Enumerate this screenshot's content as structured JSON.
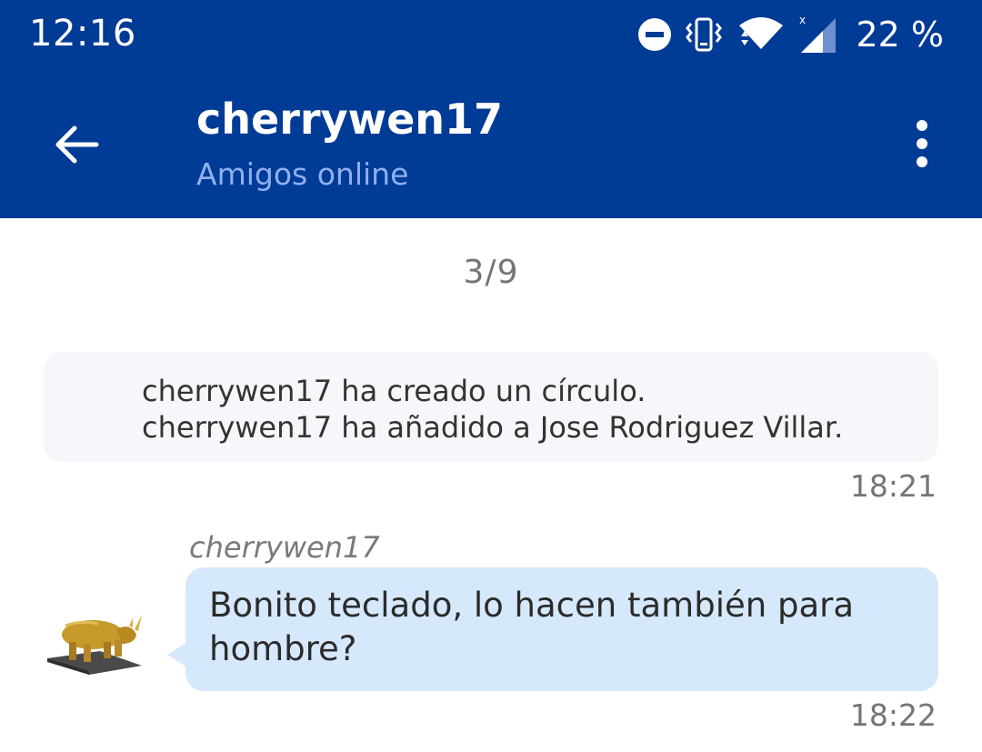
{
  "status_bar": {
    "time": "12:16",
    "battery": "22 %",
    "icons": [
      "do-not-disturb-icon",
      "vibrate-icon",
      "wifi-icon",
      "cell-signal-icon"
    ]
  },
  "header": {
    "back_icon": "arrow-left-icon",
    "title": "cherrywen17",
    "subtitle": "Amigos online",
    "menu_icon": "more-vert-icon"
  },
  "chat": {
    "page_indicator": "3/9",
    "system_message": {
      "lines": [
        "cherrywen17 ha creado un círculo.",
        "cherrywen17 ha añadido a Jose Rodriguez Villar."
      ],
      "time": "18:21"
    },
    "message": {
      "sender": "cherrywen17",
      "text": "Bonito teclado, lo hacen también para hombre?",
      "time": "18:22"
    }
  },
  "colors": {
    "header_bg": "#003b96",
    "subtitle": "#8fb0f0",
    "bubble_bg": "#d6e8fb",
    "system_card_bg": "#f6f7fa"
  }
}
